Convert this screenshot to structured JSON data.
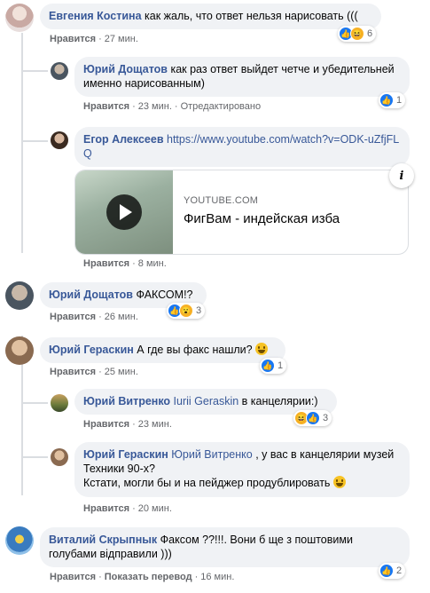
{
  "comments": [
    {
      "author": "Евгения Костина",
      "text": " как жаль, что ответ нельзя нарисовать (((",
      "like": "Нравится",
      "time": "27 мин.",
      "reactions": "6",
      "avatar_color": "#d9c7c9"
    },
    {
      "author": "Юрий Дощатов",
      "text": " как раз ответ выйдет четче и убедительней именно нарисованным)",
      "like": "Нравится",
      "time": "23 мин.",
      "edited": "Отредактировано",
      "reactions": "1",
      "avatar_color": "#4a5560"
    },
    {
      "author": "Егор Алексеев",
      "link": " https://www.youtube.com/watch?v=ODK-uZfjFLQ",
      "like": "Нравится",
      "time": "8 мин.",
      "avatar_color": "#5a4a3a",
      "card": {
        "domain": "YOUTUBE.COM",
        "title": "ФигВам - индейская изба"
      }
    },
    {
      "author": "Юрий Дощатов",
      "text": " ФАКСОМ!?",
      "like": "Нравится",
      "time": "26 мин.",
      "reactions": "3",
      "avatar_color": "#4a5560"
    },
    {
      "author": "Юрий Гераскин",
      "text": " А где вы факс нашли? ",
      "like": "Нравится",
      "time": "25 мин.",
      "reactions": "1",
      "avatar_color": "#8a6a50"
    },
    {
      "author": "Юрий Витренко",
      "mention": " Iurii Geraskin",
      "text": " в канцелярии:)",
      "like": "Нравится",
      "time": "23 мин.",
      "reactions": "3",
      "avatar_color": "#7a8a4a"
    },
    {
      "author": "Юрий Гераскин",
      "mention": " Юрий Витренко",
      "text": " , у вас в канцелярии музей Техники 90-х?",
      "text2": "Кстати, могли бы и на пейджер продублировать ",
      "like": "Нравится",
      "time": "20 мин.",
      "avatar_color": "#8a6a50"
    },
    {
      "author": "Виталий Скрыпнык",
      "text": " Факсом ??!!!. Вони б ще з поштовими голубами відправили )))",
      "like": "Нравится",
      "translate": "Показать перевод",
      "time": "16 мин.",
      "reactions": "2",
      "avatar_color": "#3a7bbf"
    }
  ]
}
